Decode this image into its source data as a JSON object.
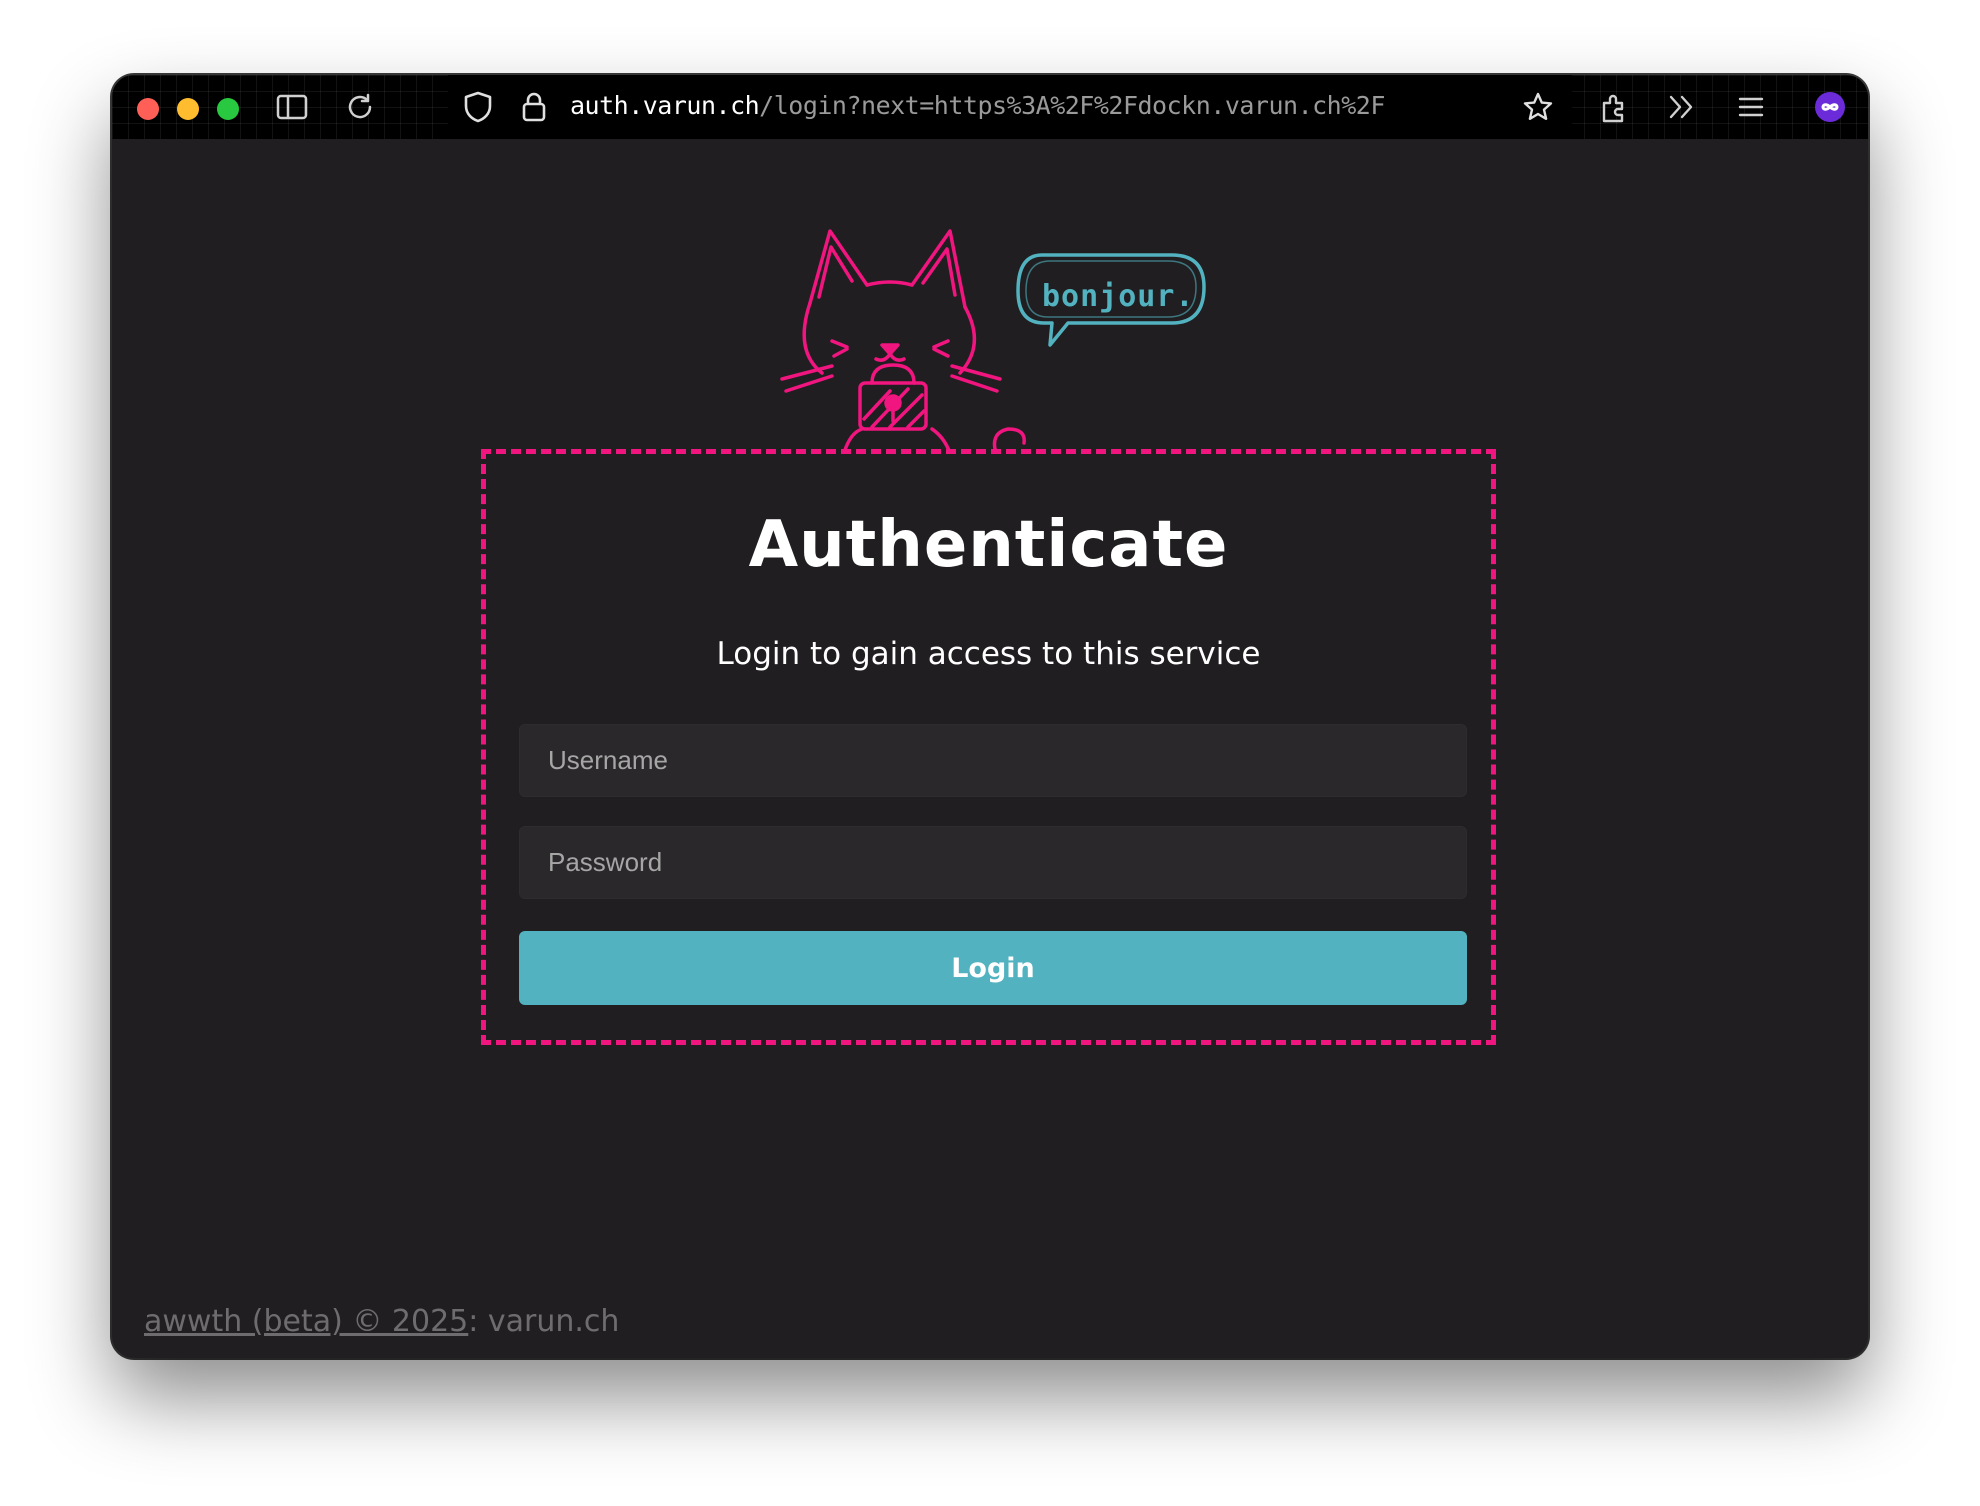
{
  "browser": {
    "url_host": "auth.varun.ch",
    "url_path": "/login?next=https%3A%2F%2Fdockn.varun.ch%2F",
    "icons": [
      "sidebar-icon",
      "reload-icon",
      "shield-icon",
      "lock-icon",
      "star-icon",
      "extensions-icon",
      "overflow-icon",
      "menu-icon",
      "profile-icon"
    ],
    "colors": {
      "close": "#ff5f57",
      "minimize": "#febc2e",
      "zoom": "#28c840",
      "profile": "#6b2bd9"
    }
  },
  "mascot": {
    "speech": "bonjour.",
    "colors": {
      "cat": "#f0157f",
      "bubble": "#52b2c0"
    }
  },
  "auth": {
    "title": "Authenticate",
    "subtitle": "Login to gain access to this service",
    "username_placeholder": "Username",
    "password_placeholder": "Password",
    "login_label": "Login"
  },
  "footer": {
    "link_text": "awwth (beta) © 2025",
    "suffix": ": varun.ch"
  },
  "theme": {
    "accent": "#f0157f",
    "button": "#52b2c0",
    "background": "#201e20"
  }
}
